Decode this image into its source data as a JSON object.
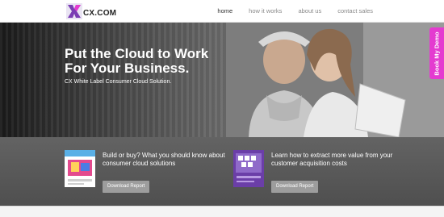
{
  "header": {
    "logo_text": "CX.COM",
    "nav": [
      "home",
      "how it works",
      "about us",
      "contact sales"
    ],
    "active_nav": "home"
  },
  "hero": {
    "title_line1": "Put the Cloud to Work",
    "title_line2": "For Your Business.",
    "subtitle": "CX White Label Consumer Cloud Solution."
  },
  "demo_tab": {
    "label": "Book My Demo",
    "color": "#e43bd0"
  },
  "cards": [
    {
      "text": "Build or buy? What you should know about consumer cloud solutions",
      "button": "Download Report"
    },
    {
      "text": "Learn how to extract more value from your customer acquisition costs",
      "button": "Download Report"
    }
  ],
  "colors": {
    "accent": "#e43bd0",
    "band": "#5a5a5a"
  }
}
